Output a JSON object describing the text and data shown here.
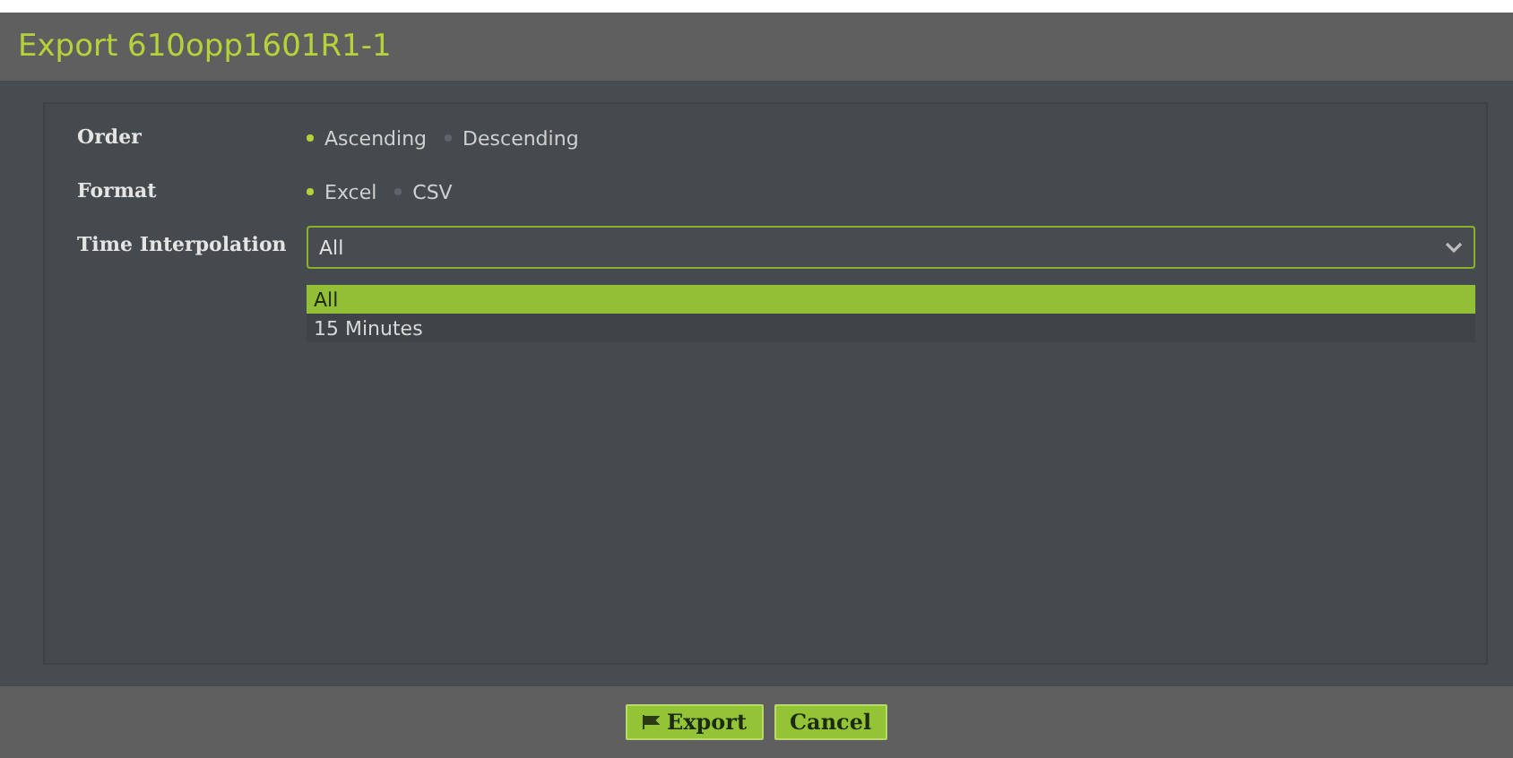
{
  "dialog": {
    "title": "Export 610opp1601R1-1"
  },
  "fields": [
    {
      "label": "Order",
      "kind": "radio",
      "options": [
        {
          "label": "Ascending",
          "selected": true
        },
        {
          "label": "Descending",
          "selected": false
        }
      ]
    },
    {
      "label": "Format",
      "kind": "radio",
      "options": [
        {
          "label": "Excel",
          "selected": true
        },
        {
          "label": "CSV",
          "selected": false
        }
      ]
    },
    {
      "label": "Time Interpolation",
      "kind": "select",
      "value": "All",
      "expanded": true,
      "options": [
        {
          "label": "All",
          "selected": true
        },
        {
          "label": "15 Minutes",
          "selected": false
        }
      ]
    }
  ],
  "buttons": [
    {
      "label": "Export",
      "kind": "export"
    },
    {
      "label": "Cancel",
      "kind": "cancel"
    }
  ]
}
